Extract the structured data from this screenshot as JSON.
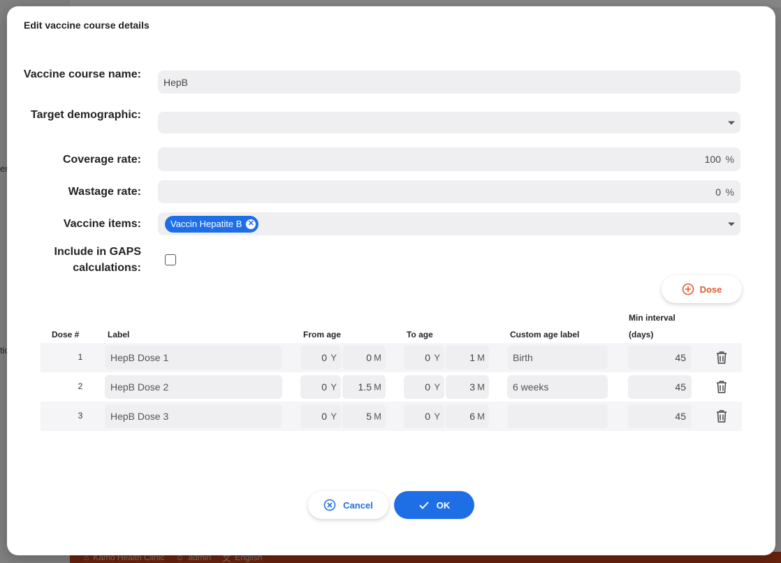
{
  "background": {
    "footer": {
      "clinic": "Kamo Health Clinic",
      "user": "admin",
      "language": "English"
    },
    "side_fragments": [
      "en",
      "tic"
    ]
  },
  "dialog": {
    "title": "Edit vaccine course details",
    "fields": {
      "course_name": {
        "label": "Vaccine course name:",
        "value": "HepB"
      },
      "target_demographic": {
        "label": "Target demographic:",
        "value": ""
      },
      "coverage_rate": {
        "label": "Coverage rate:",
        "value": "100",
        "unit": "%"
      },
      "wastage_rate": {
        "label": "Wastage rate:",
        "value": "0",
        "unit": "%"
      },
      "vaccine_items": {
        "label": "Vaccine items:",
        "chips": [
          "Vaccin Hepatite B"
        ]
      },
      "gaps": {
        "label": "Include in GAPS calculations:",
        "checked": false
      }
    },
    "add_dose_label": "Dose",
    "table": {
      "headers": {
        "dose": "Dose #",
        "label": "Label",
        "from_age": "From age",
        "to_age": "To age",
        "custom_age_label": "Custom age label",
        "min_interval_line1": "Min interval",
        "min_interval_line2": "(days)"
      },
      "year_unit": "Y",
      "month_unit": "M",
      "rows": [
        {
          "dose": "1",
          "label": "HepB Dose 1",
          "from_y": "0",
          "from_m": "0",
          "to_y": "0",
          "to_m": "1",
          "custom": "Birth",
          "interval": "45"
        },
        {
          "dose": "2",
          "label": "HepB Dose 2",
          "from_y": "0",
          "from_m": "1.5",
          "to_y": "0",
          "to_m": "3",
          "custom": "6 weeks",
          "interval": "45"
        },
        {
          "dose": "3",
          "label": "HepB Dose 3",
          "from_y": "0",
          "from_m": "5",
          "to_y": "0",
          "to_m": "6",
          "custom": "",
          "interval": "45"
        }
      ]
    },
    "buttons": {
      "cancel": "Cancel",
      "ok": "OK"
    },
    "colors": {
      "primary": "#1e6fe6",
      "accent": "#e05a2c"
    }
  }
}
